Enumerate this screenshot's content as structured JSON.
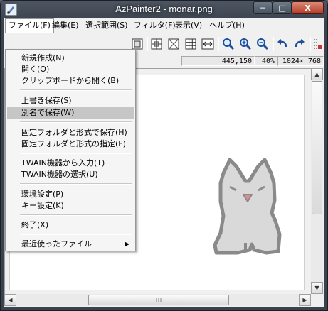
{
  "window": {
    "title": "AzPainter2 - monar.png",
    "min_label": "─",
    "max_label": "□",
    "close_label": "X"
  },
  "menubar": [
    "ファイル(F)",
    "編集(E)",
    "選択範囲(S)",
    "フィルタ(F)",
    "表示(V)",
    "ヘルプ(H)"
  ],
  "status": {
    "coords": "445,150",
    "zoom": "40%",
    "size": "1024× 768"
  },
  "file_menu": {
    "items": [
      {
        "label": "新規作成(N)",
        "highlighted": false
      },
      {
        "label": "開く(O)",
        "highlighted": false
      },
      {
        "label": "クリップボードから開く(B)",
        "highlighted": false
      },
      {
        "label": "上書き保存(S)",
        "highlighted": false
      },
      {
        "label": "別名で保存(W)",
        "highlighted": true
      },
      {
        "label": "固定フォルダと形式で保存(H)",
        "highlighted": false
      },
      {
        "label": "固定フォルダと形式の指定(F)",
        "highlighted": false
      },
      {
        "label": "TWAIN機器から入力(T)",
        "highlighted": false
      },
      {
        "label": "TWAIN機器の選択(U)",
        "highlighted": false
      },
      {
        "label": "環境設定(P)",
        "highlighted": false
      },
      {
        "label": "キー設定(K)",
        "highlighted": false
      },
      {
        "label": "終了(X)",
        "highlighted": false
      },
      {
        "label": "最近使ったファイル",
        "highlighted": false,
        "submenu": true
      }
    ]
  },
  "colors": {
    "highlight": "#c6c6c6",
    "canvas_bg": "#ffffff",
    "cat_fill": "#d9d9d9",
    "cat_stroke": "#8a8a8a",
    "mouth": "#e58a8a"
  },
  "toolbar_icons": [
    "canvas-resize-icon",
    "grid-icon",
    "checker-icon",
    "table-grid-icon",
    "fit-width-icon",
    "zoom-tool-icon",
    "zoom-in-icon",
    "zoom-out-icon",
    "undo-icon",
    "redo-icon",
    "extra-tool-icon"
  ]
}
